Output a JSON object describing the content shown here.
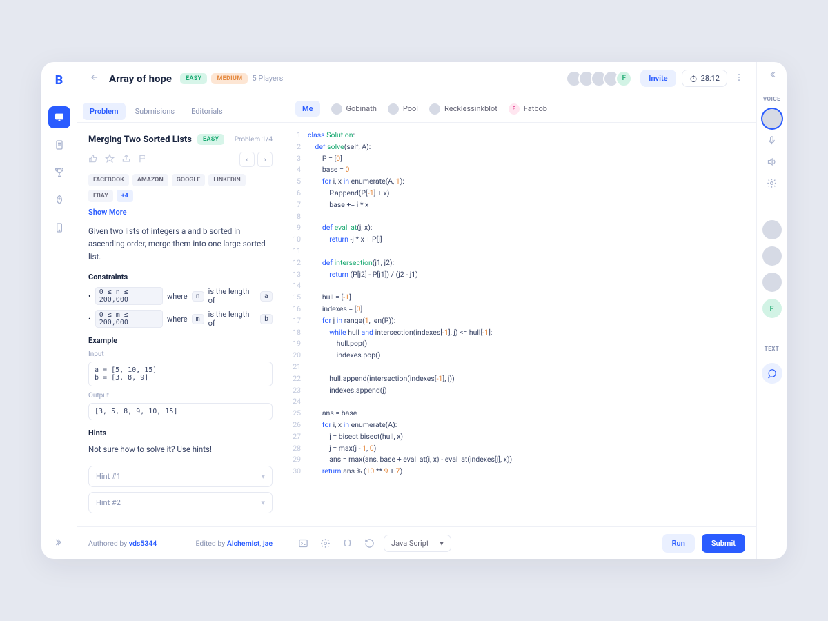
{
  "header": {
    "title": "Array of hope",
    "easy": "EASY",
    "medium": "MEDIUM",
    "players": "5 Players",
    "invite": "Invite",
    "timer": "28:12",
    "stack_letter": "F"
  },
  "left_tabs": [
    "Problem",
    "Submisions",
    "Editorials"
  ],
  "problem": {
    "title": "Merging Two Sorted Lists",
    "badge": "EASY",
    "meta": "Problem 1/4",
    "tags": [
      "FACEBOOK",
      "AMAZON",
      "GOOGLE",
      "LINKEDIN",
      "EBAY"
    ],
    "tag_more": "+4",
    "show_more": "Show More",
    "description": "Given two lists of integers a and b sorted in ascending order, merge them into one large sorted list.",
    "constraints_label": "Constraints",
    "constraints": [
      {
        "range": "0 ≤ n ≤ 200,000",
        "mid": "where",
        "var": "n",
        "tail": "is the length of",
        "arr": "a"
      },
      {
        "range": "0 ≤ m ≤ 200,000",
        "mid": "where",
        "var": "m",
        "tail": "is the length of",
        "arr": "b"
      }
    ],
    "example_label": "Example",
    "input_label": "Input",
    "input": "a = [5, 10, 15]\nb = [3, 8, 9]",
    "output_label": "Output",
    "output": "[3, 5, 8, 9, 10, 15]",
    "hints_label": "Hints",
    "hints_text": "Not sure how to solve it? Use hints!",
    "hints": [
      "Hint #1",
      "Hint #2"
    ]
  },
  "player_tabs": [
    {
      "label": "Me",
      "active": true
    },
    {
      "label": "Gobinath"
    },
    {
      "label": "Pool"
    },
    {
      "label": "Recklessinkblot"
    },
    {
      "label": "Fatbob",
      "badge": "F"
    }
  ],
  "footer": {
    "authored_pre": "Authored by ",
    "authored_by": "vds5344",
    "edited_pre": "Edited by ",
    "edited_by1": "Alchemist",
    "edited_by2": "jae",
    "language": "Java Script",
    "run": "Run",
    "submit": "Submit"
  },
  "rail_right": {
    "voice": "VOICE",
    "text": "TEXT",
    "letter": "F"
  },
  "code_lines": 30
}
